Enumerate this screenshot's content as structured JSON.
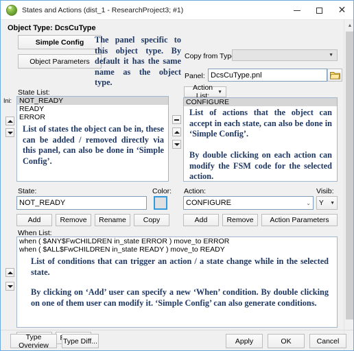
{
  "window": {
    "title": "States and Actions (dist_1 - ResearchProject3; #1)",
    "icon": "app-globe-icon",
    "minimize_label": "Minimize",
    "maximize_label": "Maximize",
    "close_label": "Close",
    "close_glyph": "✕"
  },
  "header": {
    "object_type_label": "Object Type: DcsCuType",
    "simple_config_button": "Simple Config",
    "object_parameters_button": "Object Parameters",
    "copy_from_type_label": "Copy from Type:",
    "copy_from_type_value": "",
    "panel_label": "Panel:",
    "panel_value": "DcsCuType.pnl",
    "browse_icon": "folder-icon"
  },
  "annotations": {
    "panel_note": "The panel specific to this object type. By default it has the same name as the object type.",
    "state_list_note": "List of states the object can be in, these can be added / removed directly via this panel, can also be done in ‘Simple Config’.",
    "action_list_note_1": "List of actions that the object can accept in each state, can also be done in ‘Simple Config’.",
    "action_list_note_2": "By double clicking on each action can modify the FSM code for the selected action.",
    "when_list_note_1": "List of conditions that can trigger an action / a state change while in the selected state.",
    "when_list_note_2": "By clicking on ‘Add’ user can specify a new ‘When’ condition. By double clicking on one of them user can modify it. ‘Simple Config’ can also generate conditions."
  },
  "state_panel": {
    "list_label": "State List:",
    "initial_label": "Ini:",
    "items": [
      "NOT_READY",
      "READY",
      "ERROR"
    ],
    "selected_index": 0,
    "move_up_icon": "arrow-up-icon",
    "move_down_icon": "arrow-down-icon",
    "state_field_label": "State:",
    "state_field_value": "NOT_READY",
    "color_label": "Color:",
    "color_value": "#e0e0e0",
    "buttons": [
      "Add",
      "Remove",
      "Rename",
      "Copy"
    ]
  },
  "action_panel": {
    "list_label": "Action List:",
    "list_dropdown_icon": "chevron-down-icon",
    "items": [
      "CONFIGURE"
    ],
    "selected_index": 0,
    "equalize_icon": "minus-icon",
    "move_up_icon": "arrow-up-icon",
    "move_down_icon": "arrow-down-icon",
    "action_field_label": "Action:",
    "action_field_value": "CONFIGURE",
    "action_field_icon": "chevron-down-icon",
    "visib_label": "Visib:",
    "visib_value": "Y",
    "visib_icon": "chevron-down-icon",
    "buttons": [
      "Add",
      "Remove",
      "Action Parameters"
    ]
  },
  "when_panel": {
    "list_label": "When List:",
    "items": [
      "when ( $ANY$FwCHILDREN in_state ERROR ) move_to ERROR",
      "when ( $ALL$FwCHILDREN in_state READY ) move_to READY"
    ],
    "move_up_icon": "arrow-up-icon",
    "move_down_icon": "arrow-down-icon",
    "buttons": [
      "Add",
      "Remove"
    ]
  },
  "footer": {
    "left_buttons": [
      "Type Overview",
      "Type Diff..."
    ],
    "right_buttons": [
      "Apply",
      "OK",
      "Cancel"
    ]
  },
  "scrollbar": {
    "up_icon": "caret-up-icon",
    "thumb_name": "vertical-scrollbar-thumb"
  },
  "colors": {
    "annotation_text": "#1f3864",
    "window_border": "#6fa8dc",
    "selection": "#d6d6d6",
    "field_border": "#7f9db9"
  }
}
